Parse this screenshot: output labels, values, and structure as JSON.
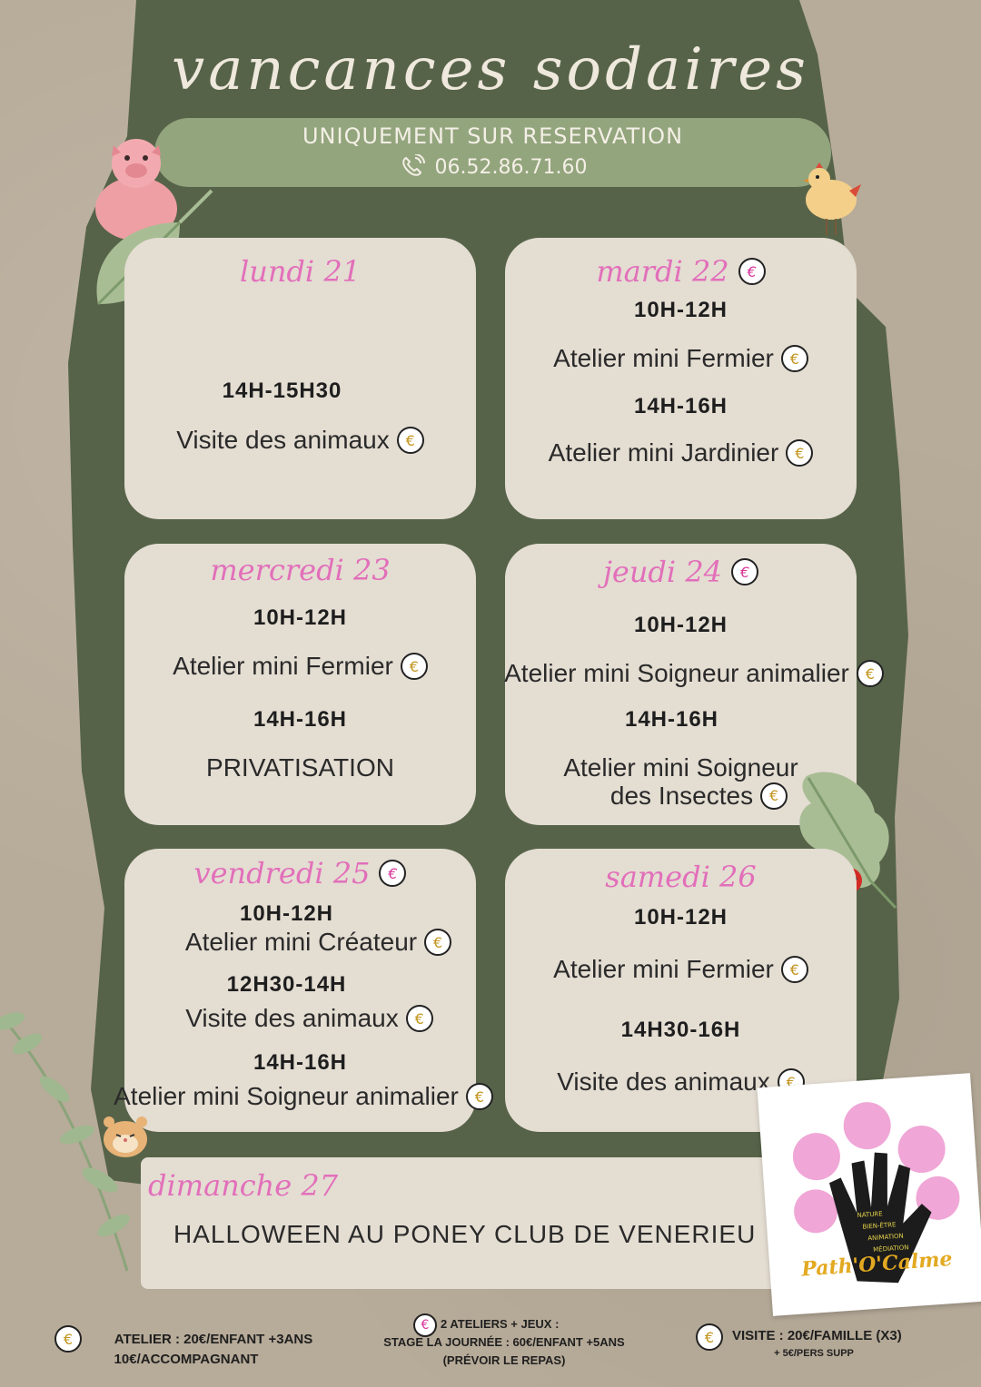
{
  "title": "vancances sodaires",
  "reservation": {
    "line1": "UNIQUEMENT SUR RESERVATION",
    "phone": "06.52.86.71.60",
    "phone_icon": "phone-icon"
  },
  "days": {
    "lundi": {
      "day": "lundi 21",
      "time1": "14H-15H30",
      "act1": "Visite des animaux"
    },
    "mardi": {
      "day": "mardi 22",
      "time1": "10H-12H",
      "act1": "Atelier mini Fermier",
      "time2": "14H-16H",
      "act2": "Atelier mini Jardinier"
    },
    "mercredi": {
      "day": "mercredi 23",
      "time1": "10H-12H",
      "act1": "Atelier mini Fermier",
      "time2": "14H-16H",
      "act2": "PRIVATISATION"
    },
    "jeudi": {
      "day": "jeudi 24",
      "time1": "10H-12H",
      "act1": "Atelier mini Soigneur animalier",
      "time2": "14H-16H",
      "act2_line1": "Atelier mini Soigneur",
      "act2_line2": "des Insectes"
    },
    "vendredi": {
      "day": "vendredi 25",
      "time1": "10H-12H",
      "act1": "Atelier mini Créateur",
      "time2": "12H30-14H",
      "act2": "Visite des animaux",
      "time3": "14H-16H",
      "act3": "Atelier mini Soigneur animalier"
    },
    "samedi": {
      "day": "samedi 26",
      "time1": "10H-12H",
      "act1": "Atelier mini Fermier",
      "time2": "14H30-16H",
      "act2": "Visite des animaux"
    },
    "dimanche": {
      "day": "dimanche 27",
      "act1": "HALLOWEEN AU PONEY CLUB DE VENERIEU"
    }
  },
  "euro_symbol": "€",
  "footer": {
    "atelier_line1": "ATELIER : 20€/ENFANT +3ANS",
    "atelier_line2": "10€/ACCOMPAGNANT",
    "stage_line1": "2 ATELIERS + JEUX :",
    "stage_line2": "STAGE LA JOURNÉE : 60€/ENFANT  +5ANS",
    "stage_line3": "(PRÉVOIR LE REPAS)",
    "visite_line1": "VISITE : 20€/FAMILLE (X3)",
    "visite_line2": "+ 5€/PERS SUPP"
  },
  "logo": {
    "text": "Path'O'Calme",
    "words": [
      "NATURE",
      "BIEN-ÊTRE",
      "ANIMATION",
      "MÉDIATION"
    ]
  },
  "colors": {
    "green_bg": "#566349",
    "card_bg": "#e4ddd2",
    "reservation_bg": "#93a57d",
    "pink": "#e26fba",
    "gold": "#c2951f"
  }
}
